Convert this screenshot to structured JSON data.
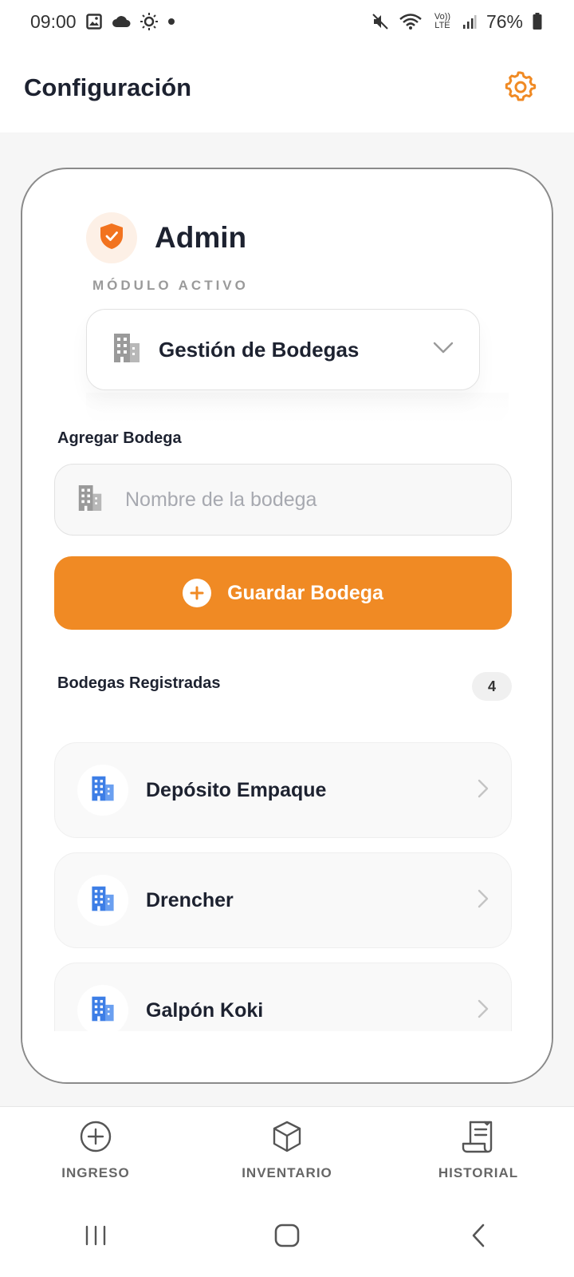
{
  "status_bar": {
    "time": "09:00",
    "battery": "76%",
    "signal_label": "Vo)) LTE"
  },
  "header": {
    "title": "Configuración",
    "settings_icon": "gear-icon"
  },
  "profile": {
    "name": "Admin"
  },
  "module": {
    "caption": "MÓDULO ACTIVO",
    "selected": "Gestión de Bodegas"
  },
  "add_section": {
    "title": "Agregar Bodega",
    "input_placeholder": "Nombre de la bodega",
    "input_value": "",
    "save_label": "Guardar Bodega"
  },
  "registered": {
    "title": "Bodegas Registradas",
    "count": "4",
    "items": [
      {
        "name": "Depósito Empaque"
      },
      {
        "name": "Drencher"
      },
      {
        "name": "Galpón Koki"
      }
    ]
  },
  "bottom_nav": {
    "items": [
      {
        "label": "INGRESO",
        "icon": "plus-circle-icon"
      },
      {
        "label": "INVENTARIO",
        "icon": "box-icon"
      },
      {
        "label": "HISTORIAL",
        "icon": "receipt-icon"
      }
    ]
  },
  "colors": {
    "accent": "#F08A24",
    "building_blue": "#3D7EE6",
    "text": "#1D2230"
  }
}
